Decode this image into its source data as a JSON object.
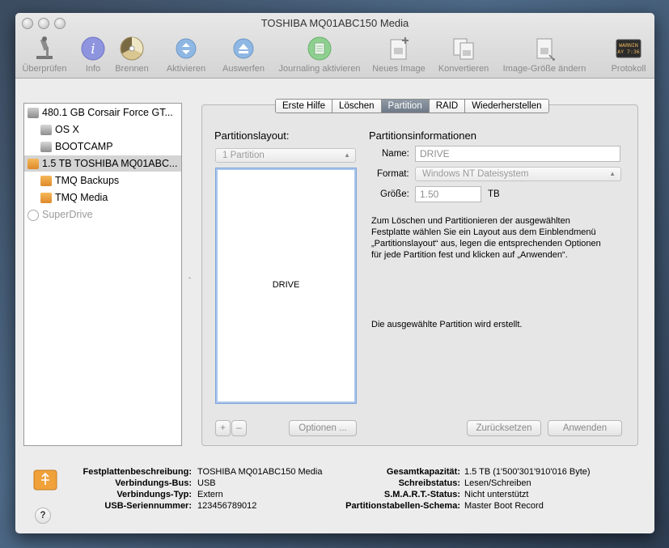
{
  "window": {
    "title": "TOSHIBA MQ01ABC150 Media"
  },
  "toolbar": {
    "items": [
      {
        "label": "Überprüfen",
        "icon": "microscope-icon"
      },
      {
        "label": "Info",
        "icon": "info-icon"
      },
      {
        "label": "Brennen",
        "icon": "burn-icon"
      },
      {
        "label": "Aktivieren",
        "icon": "mount-icon"
      },
      {
        "label": "Auswerfen",
        "icon": "eject-icon"
      },
      {
        "label": "Journaling aktivieren",
        "icon": "journaling-icon"
      },
      {
        "label": "Neues Image",
        "icon": "new-image-icon"
      },
      {
        "label": "Konvertieren",
        "icon": "convert-icon"
      },
      {
        "label": "Image-Größe ändern",
        "icon": "resize-image-icon"
      },
      {
        "label": "Protokoll",
        "icon": "log-icon",
        "log_text": "WARNIN\nAY 7:36"
      }
    ]
  },
  "sidebar": {
    "items": [
      {
        "label": "480.1 GB Corsair Force GT...",
        "icon": "internal-disk-icon"
      },
      {
        "label": "OS X",
        "icon": "volume-icon"
      },
      {
        "label": "BOOTCAMP",
        "icon": "volume-icon"
      },
      {
        "label": "1.5 TB TOSHIBA MQ01ABC...",
        "icon": "external-disk-icon"
      },
      {
        "label": "TMQ Backups",
        "icon": "external-volume-icon"
      },
      {
        "label": "TMQ Media",
        "icon": "external-volume-icon"
      },
      {
        "label": "SuperDrive",
        "icon": "superdrive-icon"
      }
    ]
  },
  "tabs": [
    "Erste Hilfe",
    "Löschen",
    "Partition",
    "RAID",
    "Wiederherstellen"
  ],
  "partition": {
    "layout_heading": "Partitionslayout:",
    "layout_value": "1 Partition",
    "partition_name": "DRIVE",
    "add_symbol": "+",
    "remove_symbol": "–",
    "options_button": "Optionen ...",
    "info_heading": "Partitionsinformationen",
    "name_label": "Name:",
    "name_value": "DRIVE",
    "format_label": "Format:",
    "format_value": "Windows NT Dateisystem",
    "size_label": "Größe:",
    "size_value": "1.50",
    "size_unit": "TB",
    "help_text": "Zum Löschen und Partitionieren der ausgewählten\nFestplatte wählen Sie ein Layout aus dem Einblendmenü\n„Partitionslayout“ aus, legen die entsprechenden Optionen\nfür jede Partition fest und klicken auf „Anwenden“.",
    "status_text": "Die ausgewählte Partition wird erstellt.",
    "reset_button": "Zurücksetzen",
    "apply_button": "Anwenden"
  },
  "details": {
    "left": [
      {
        "key": "Festplattenbeschreibung:",
        "value": "TOSHIBA MQ01ABC150 Media"
      },
      {
        "key": "Verbindungs-Bus:",
        "value": "USB"
      },
      {
        "key": "Verbindungs-Typ:",
        "value": "Extern"
      },
      {
        "key": "USB-Seriennummer:",
        "value": "123456789012"
      }
    ],
    "right": [
      {
        "key": "Gesamtkapazität:",
        "value": "1.5 TB (1'500'301'910'016 Byte)"
      },
      {
        "key": "Schreibstatus:",
        "value": "Lesen/Schreiben"
      },
      {
        "key": "S.M.A.R.T.-Status:",
        "value": "Nicht unterstützt"
      },
      {
        "key": "Partitionstabellen-Schema:",
        "value": "Master Boot Record"
      }
    ],
    "help_symbol": "?"
  },
  "colors": {
    "selection": "#d4d4d4",
    "tab_active": "#75808d",
    "usb_drive": "#f0a13a"
  }
}
